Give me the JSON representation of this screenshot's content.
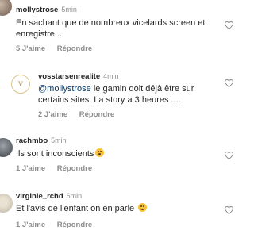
{
  "comments": [
    {
      "username": "mollystrose",
      "time": "5min",
      "text_lines": [
        "En sachant que de nombreux vicelards screen et",
        "enregistre..."
      ],
      "likes": "5 J'aime",
      "reply": "Répondre",
      "avatar_icon": "avatar-photo"
    },
    {
      "username": "vosstarsenrealite",
      "time": "4min",
      "mention": "@mollystrose",
      "text_lines": [
        " le gamin doit déjà être sur",
        "certains sites. La story a 3 heures ...."
      ],
      "likes": "2 J'aime",
      "reply": "Répondre",
      "avatar_icon": "avatar-logo"
    },
    {
      "username": "rachmbo",
      "time": "5min",
      "text": "Ils sont inconscients",
      "emoji": "astonished-face-emoji",
      "likes": "1 J'aime",
      "reply": "Répondre",
      "avatar_icon": "avatar-photo"
    },
    {
      "username": "virginie_rchd",
      "time": "6min",
      "text": "Et l'avis de l'enfant on en parle ",
      "emoji": "relieved-face-emoji",
      "likes": "1 J'aime",
      "reply": "Répondre",
      "avatar_icon": "avatar-photo"
    }
  ],
  "colors": {
    "text": "#262626",
    "secondary": "#8e8e8e",
    "mention": "#00376b"
  }
}
